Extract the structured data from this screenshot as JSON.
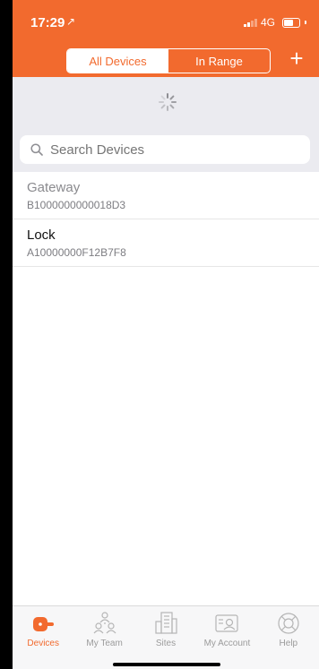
{
  "status_bar": {
    "time": "17:29",
    "location_glyph": "↗",
    "network": "4G"
  },
  "header": {
    "segments": [
      "All Devices",
      "In Range"
    ],
    "active_segment": "All Devices",
    "add_symbol": "+"
  },
  "search": {
    "placeholder": "Search Devices",
    "icon": "search-icon"
  },
  "devices": [
    {
      "name": "Gateway",
      "id": "B1000000000018D3"
    },
    {
      "name": "Lock",
      "id": "A10000000F12B7F8"
    }
  ],
  "tabs": [
    {
      "label": "Devices",
      "icon": "devices-icon",
      "active": true
    },
    {
      "label": "My Team",
      "icon": "team-icon",
      "active": false
    },
    {
      "label": "Sites",
      "icon": "sites-icon",
      "active": false
    },
    {
      "label": "My Account",
      "icon": "account-icon",
      "active": false
    },
    {
      "label": "Help",
      "icon": "help-icon",
      "active": false
    }
  ],
  "colors": {
    "accent": "#f26a2e",
    "background_gray": "#ebebf0",
    "inactive_tab": "#9b9b9b"
  }
}
